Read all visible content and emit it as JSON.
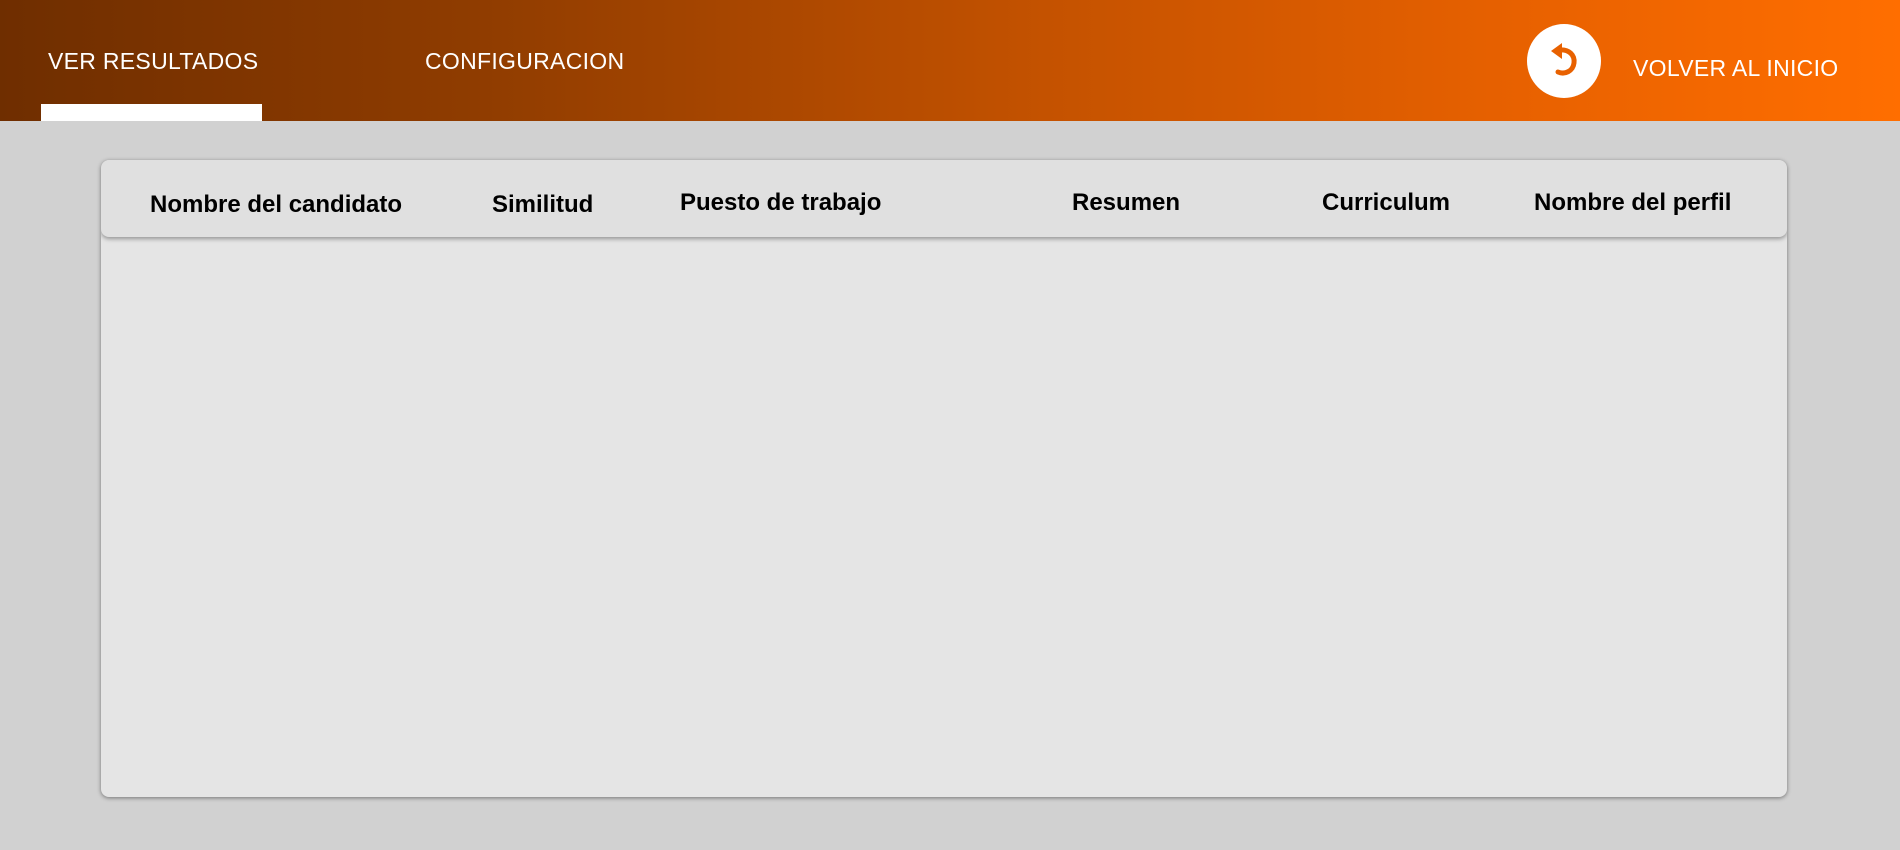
{
  "topbar": {
    "tabs": [
      {
        "label": "VER RESULTADOS",
        "active": true
      },
      {
        "label": "CONFIGURACION",
        "active": false
      }
    ],
    "home": {
      "icon": "undo-arrow-icon",
      "label": "VOLVER AL INICIO"
    },
    "colors": {
      "gradient_start": "#6f2e00",
      "gradient_end": "#ff6e00",
      "accent": "#e86100"
    }
  },
  "table": {
    "columns": [
      "Nombre del candidato",
      "Similitud",
      "Puesto de trabajo",
      "Resumen",
      "Curriculum",
      "Nombre del perfil"
    ],
    "rows": []
  }
}
